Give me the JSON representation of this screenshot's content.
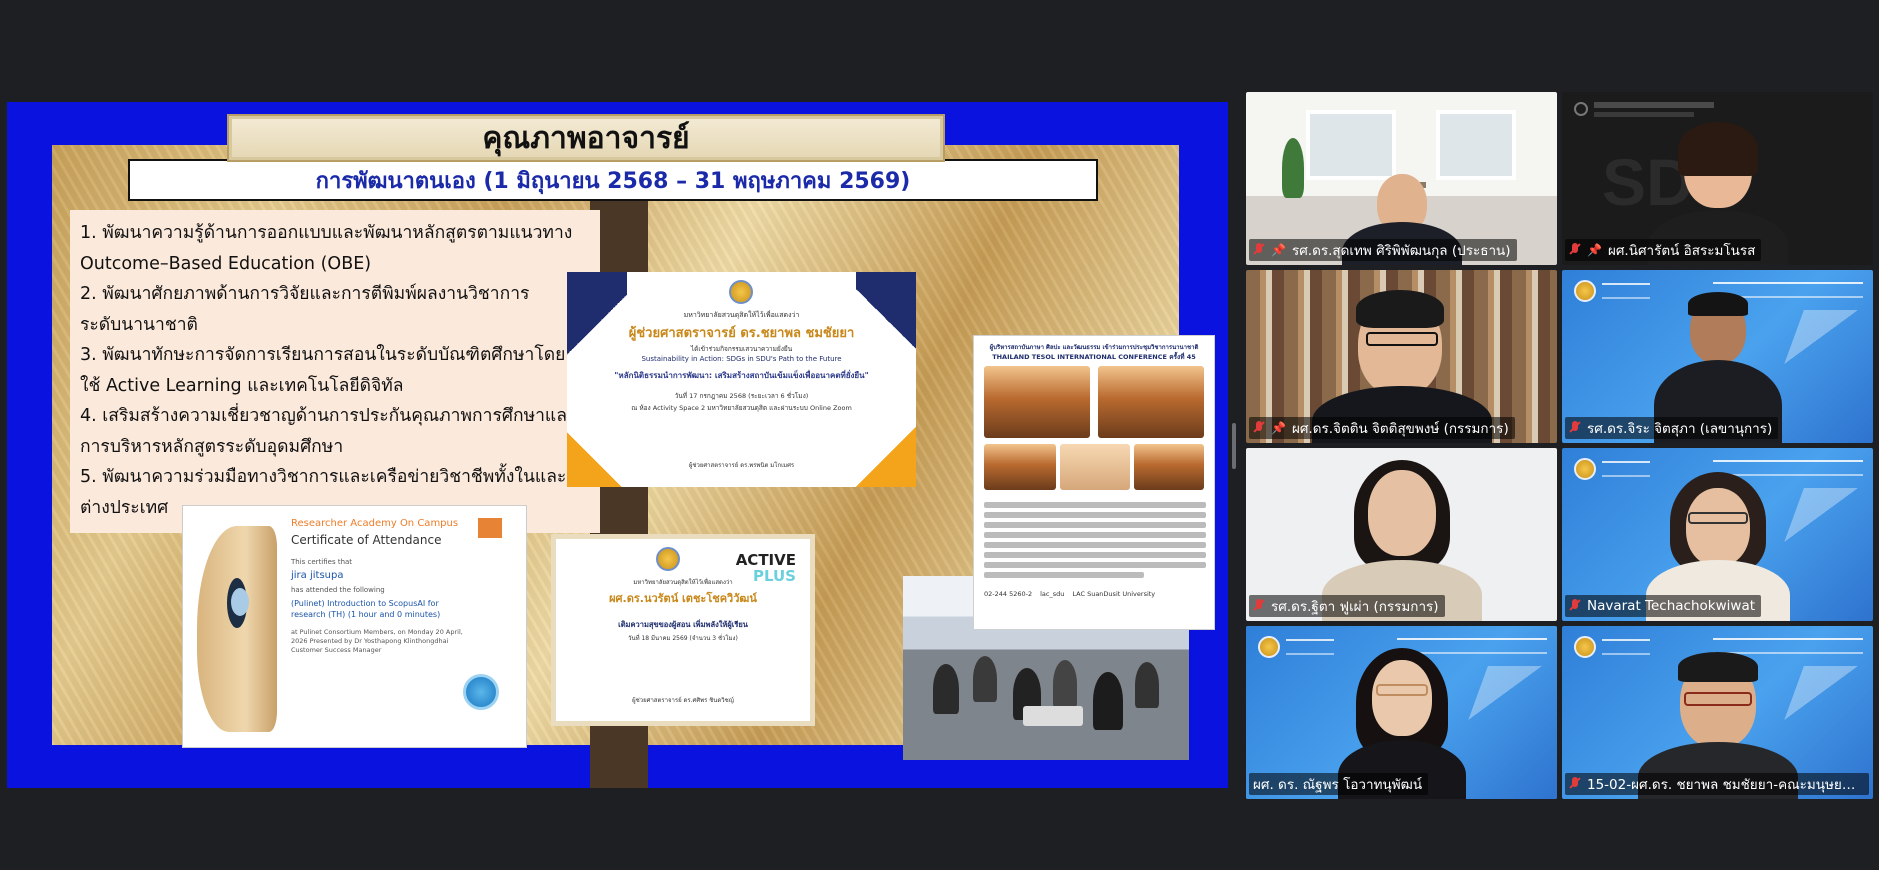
{
  "slide": {
    "title": "คุณภาพอาจารย์",
    "subtitle": "การพัฒนาตนเอง (1 มิถุนายน 2568 – 31 พฤษภาคม 2569)",
    "goals": [
      "1. พัฒนาความรู้ด้านการออกแบบและพัฒนาหลักสูตรตามแนวทาง",
      "Outcome–Based Education (OBE)",
      "2. พัฒนาศักยภาพด้านการวิจัยและการตีพิมพ์ผลงานวิชาการ",
      "ระดับนานาชาติ",
      "3. พัฒนาทักษะการจัดการเรียนการสอนในระดับบัณฑิตศึกษาโดย",
      "ใช้ Active Learning และเทคโนโลยีดิจิทัล",
      "4. เสริมสร้างความเชี่ยวชาญด้านการประกันคุณภาพการศึกษาและ",
      "การบริหารหลักสูตรระดับอุดมศึกษา",
      "5. พัฒนาความร่วมมือทางวิชาการและเครือข่ายวิชาชีพทั้งในและ",
      "ต่างประเทศ"
    ],
    "cert_elsevier": {
      "header": "Researcher Academy On Campus",
      "title": "Certificate of Attendance",
      "certifies": "This certifies that",
      "recipient": "jira jitsupa",
      "attended": "has attended the following",
      "course": "(Pulinet) Introduction to ScopusAI for research (TH) (1 hour and 0 minutes)",
      "details": "at Pulinet Consortium Members, on Monday 20 April, 2026 Presented by Dr Yosthapong Klinthongdhai Customer Success Manager"
    },
    "cert_sdu_1": {
      "intro": "มหาวิทยาลัยสวนดุสิตให้ไว้เพื่อแสดงว่า",
      "name": "ผู้ช่วยศาสตราจารย์ ดร.ชยาพล ชมชัยยา",
      "joined": "ได้เข้าร่วมกิจกรรมเสวนาความยั่งยืน",
      "event_en": "Sustainability in Action: SDGs in SDU's Path to the Future",
      "event_th": "\"หลักนิติธรรมนำการพัฒนา: เสริมสร้างสถาบันเข้มแข็งเพื่ออนาคตที่ยั่งยืน\"",
      "date": "วันที่ 17 กรกฎาคม 2568 (ระยะเวลา 6 ชั่วโมง)",
      "venue": "ณ ห้อง Activity Space 2 มหาวิทยาลัยสวนดุสิต และผ่านระบบ Online Zoom",
      "signer": "ผู้ช่วยศาสตราจารย์ ดร.พรพนิต มโกเมศร"
    },
    "cert_sdu_2": {
      "active": "ACTIVE",
      "plus": "PLUS",
      "intro": "มหาวิทยาลัยสวนดุสิตให้ไว้เพื่อแสดงว่า",
      "name": "ผศ.ดร.นวรัตน์ เตชะโชควิวัฒน์",
      "event": "เติมความสุขของผู้สอน เพิ่มพลังให้ผู้เรียน",
      "date": "วันที่ 18 มีนาคม 2569 (จำนวน 3 ชั่วโมง)",
      "signer": "ผู้ช่วยศาสตราจารย์ ดร.ศศิพร ชินดวิชญ์"
    },
    "poster_tesol": {
      "headline": "ผู้บริหารสถาบันภาษา ศิลปะ และวัฒนธรรม เข้าร่วมการประชุมวิชาการนานาชาติ",
      "conference": "THAILAND TESOL INTERNATIONAL CONFERENCE ครั้งที่ 45",
      "contact": "02-244 5260-2",
      "handle": "lac_sdu",
      "page": "LAC SuanDusit University"
    }
  },
  "participants": [
    {
      "name": "รศ.ดร.สุดเทพ ศิริพิพัฒนกุล (ประธาน)",
      "muted": true,
      "pinned": true
    },
    {
      "name": "ผศ.นิศารัตน์ อิสระมโนรส",
      "muted": true,
      "pinned": true
    },
    {
      "name": "ผศ.ดร.จิตติน จิตติสุขพงษ์ (กรรมการ)",
      "muted": true,
      "pinned": true
    },
    {
      "name": "รศ.ดร.จิระ จิตสุภา (เลขานุการ)",
      "muted": true,
      "pinned": false
    },
    {
      "name": "รศ.ดร.ฐิตา ฟูเผ่า (กรรมการ)",
      "muted": true,
      "pinned": false
    },
    {
      "name": "Navarat Techachokwiwat",
      "muted": true,
      "pinned": false
    },
    {
      "name": "ผศ. ดร. ณัฐพร โอวาทนุพัฒน์",
      "muted": false,
      "pinned": false,
      "active": true
    },
    {
      "name": "15-02-ผศ.ดร. ชยาพล ชมชัยยา-คณะมนุษยศ...",
      "muted": true,
      "pinned": false
    }
  ],
  "colors": {
    "active_speaker": "#27d36b",
    "slide_bg": "#0a12e0",
    "subtitle_text": "#1a2aa8"
  },
  "icons": {
    "mic_muted": "mic-muted-icon",
    "pin": "pin-icon"
  }
}
